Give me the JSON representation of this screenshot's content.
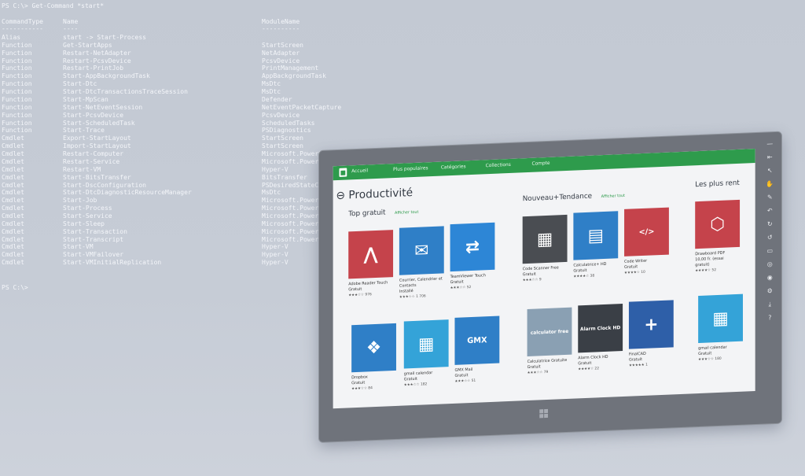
{
  "terminal": {
    "command_line": "PS C:\\> Get-Command *start*",
    "headers": {
      "type": "CommandType",
      "name": "Name",
      "module": "ModuleName"
    },
    "rules": {
      "type": "-----------",
      "name": "----",
      "module": "----------"
    },
    "rows": [
      {
        "type": "Alias",
        "name": "start -> Start-Process",
        "module": ""
      },
      {
        "type": "Function",
        "name": "Get-StartApps",
        "module": "StartScreen"
      },
      {
        "type": "Function",
        "name": "Restart-NetAdapter",
        "module": "NetAdapter"
      },
      {
        "type": "Function",
        "name": "Restart-PcsvDevice",
        "module": "PcsvDevice"
      },
      {
        "type": "Function",
        "name": "Restart-PrintJob",
        "module": "PrintManagement"
      },
      {
        "type": "Function",
        "name": "Start-AppBackgroundTask",
        "module": "AppBackgroundTask"
      },
      {
        "type": "Function",
        "name": "Start-Dtc",
        "module": "MsDtc"
      },
      {
        "type": "Function",
        "name": "Start-DtcTransactionsTraceSession",
        "module": "MsDtc"
      },
      {
        "type": "Function",
        "name": "Start-MpScan",
        "module": "Defender"
      },
      {
        "type": "Function",
        "name": "Start-NetEventSession",
        "module": "NetEventPacketCapture"
      },
      {
        "type": "Function",
        "name": "Start-PcsvDevice",
        "module": "PcsvDevice"
      },
      {
        "type": "Function",
        "name": "Start-ScheduledTask",
        "module": "ScheduledTasks"
      },
      {
        "type": "Function",
        "name": "Start-Trace",
        "module": "PSDiagnostics"
      },
      {
        "type": "Cmdlet",
        "name": "Export-StartLayout",
        "module": "StartScreen"
      },
      {
        "type": "Cmdlet",
        "name": "Import-StartLayout",
        "module": "StartScreen"
      },
      {
        "type": "Cmdlet",
        "name": "Restart-Computer",
        "module": "Microsoft.PowerShell.Management"
      },
      {
        "type": "Cmdlet",
        "name": "Restart-Service",
        "module": "Microsoft.PowerShell.Management"
      },
      {
        "type": "Cmdlet",
        "name": "Restart-VM",
        "module": "Hyper-V"
      },
      {
        "type": "Cmdlet",
        "name": "Start-BitsTransfer",
        "module": "BitsTransfer"
      },
      {
        "type": "Cmdlet",
        "name": "Start-DscConfiguration",
        "module": "PSDesiredStateConfiguration"
      },
      {
        "type": "Cmdlet",
        "name": "Start-DtcDiagnosticResourceManager",
        "module": "MsDtc"
      },
      {
        "type": "Cmdlet",
        "name": "Start-Job",
        "module": "Microsoft.PowerShell.Core"
      },
      {
        "type": "Cmdlet",
        "name": "Start-Process",
        "module": "Microsoft.PowerShell.Management"
      },
      {
        "type": "Cmdlet",
        "name": "Start-Service",
        "module": "Microsoft.PowerShell.Management"
      },
      {
        "type": "Cmdlet",
        "name": "Start-Sleep",
        "module": "Microsoft.PowerShell.Utility"
      },
      {
        "type": "Cmdlet",
        "name": "Start-Transaction",
        "module": "Microsoft.PowerShell.Management"
      },
      {
        "type": "Cmdlet",
        "name": "Start-Transcript",
        "module": "Microsoft.PowerShell.Host"
      },
      {
        "type": "Cmdlet",
        "name": "Start-VM",
        "module": "Hyper-V"
      },
      {
        "type": "Cmdlet",
        "name": "Start-VMFailover",
        "module": "Hyper-V"
      },
      {
        "type": "Cmdlet",
        "name": "Start-VMInitialReplication",
        "module": "Hyper-V"
      }
    ],
    "prompt": "PS C:\\>"
  },
  "store": {
    "nav": [
      "Accueil",
      "Plus populaires",
      "Catégories",
      "Collections",
      "Compte"
    ],
    "page_title": "Productivité",
    "sections": {
      "top": {
        "title": "Top gratuit",
        "link": "Afficher tout"
      },
      "new": {
        "title": "Nouveau+Tendance",
        "link": "Afficher tout"
      },
      "best": {
        "title": "Les plus rent"
      }
    },
    "apps": [
      {
        "name": "Adobe Reader Touch\nGratuit",
        "rating": "★★★☆☆ 976",
        "color": "#c5434b",
        "glyph": "⋀"
      },
      {
        "name": "Courrier, Calendrier et\nContacts\nInstallé",
        "rating": "★★★☆☆ 1 706",
        "color": "#2f7fc7",
        "glyph": "✉"
      },
      {
        "name": "TeamViewer Touch\nGratuit",
        "rating": "★★★☆☆ 52",
        "color": "#2d86d6",
        "glyph": "⇄"
      },
      {
        "name": "Code Scanner Free\nGratuit",
        "rating": "★★★☆☆ 9",
        "color": "#4a4d52",
        "glyph": "▦"
      },
      {
        "name": "Calculatrice+ HD\nGratuit",
        "rating": "★★★★☆ 38",
        "color": "#2f7fc7",
        "glyph": "▤"
      },
      {
        "name": "Code Writer\nGratuit",
        "rating": "★★★★☆ 10",
        "color": "#c5434b",
        "glyph": "</>"
      },
      {
        "name": "Drawboard PDF\n10,00 fr.  (essai\ngratuit)",
        "rating": "★★★★☆ 52",
        "color": "#c5434b",
        "glyph": "⬡"
      },
      {
        "name": "Dropbox\nGratuit",
        "rating": "★★★☆☆ 84",
        "color": "#2f7fc7",
        "glyph": "❖"
      },
      {
        "name": "gmail calendar\nGratuit",
        "rating": "★★★☆☆ 182",
        "color": "#34a3d8",
        "glyph": "▦"
      },
      {
        "name": "GMX Mail\nGratuit",
        "rating": "★★★☆☆ 51",
        "color": "#2f7fc7",
        "glyph": "GMX"
      },
      {
        "name": "Calculatrice Gratuite\nGratuit",
        "rating": "★★★☆☆ 79",
        "color": "#8aa0b3",
        "glyph": "calculator free"
      },
      {
        "name": "Alarm Clock HD\nGratuit",
        "rating": "★★★★☆ 22",
        "color": "#3a3f46",
        "glyph": "Alarm Clock HD"
      },
      {
        "name": "FinalCAD\nGratuit",
        "rating": "★★★★★ 1",
        "color": "#2e5fa8",
        "glyph": "+"
      },
      {
        "name": "gmail calendar\nGratuit",
        "rating": "★★★☆☆ 180",
        "color": "#34a3d8",
        "glyph": "▦"
      }
    ]
  },
  "charms": [
    "—",
    "⇤",
    "↖",
    "✋",
    "✎",
    "↶",
    "↻",
    "↺",
    "▭",
    "◎",
    "◉",
    "⚙",
    "⤓",
    "?"
  ]
}
